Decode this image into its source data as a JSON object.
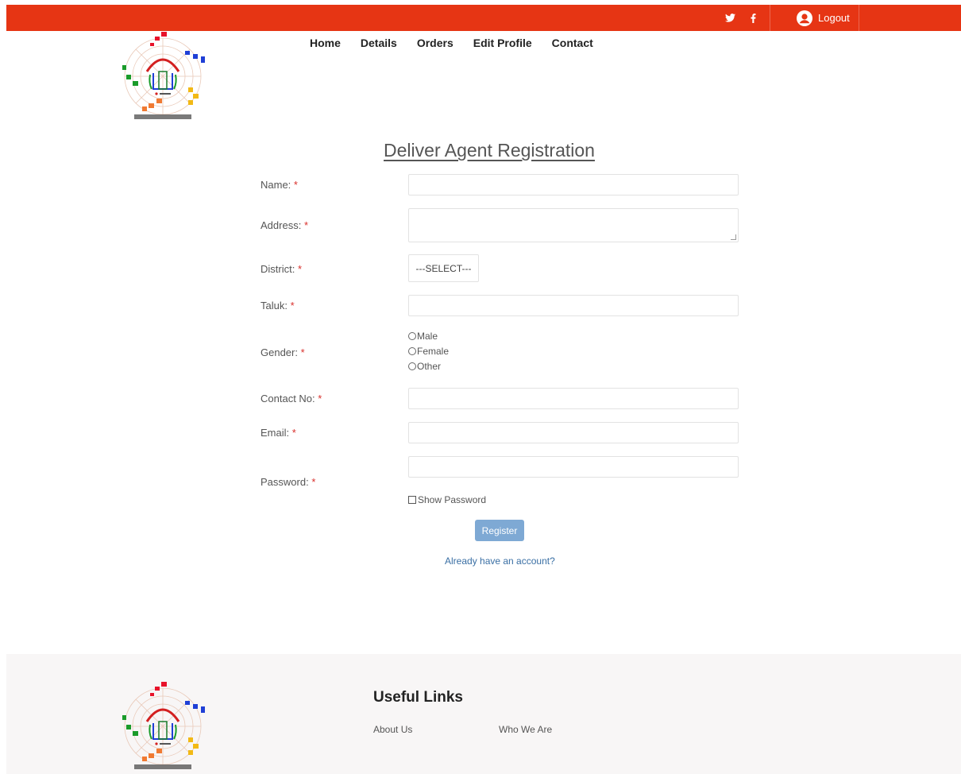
{
  "topbar": {
    "logout_label": "Logout",
    "color": "#e63514"
  },
  "nav": [
    "Home",
    "Details",
    "Orders",
    "Edit Profile",
    "Contact"
  ],
  "title": "Deliver Agent Registration",
  "form": {
    "name_label": "Name:",
    "address_label": "Address:",
    "district_label": "District:",
    "district_selected": "---SELECT---",
    "taluk_label": "Taluk:",
    "gender_label": "Gender:",
    "gender_options": [
      "Male",
      "Female",
      "Other"
    ],
    "contact_label": "Contact No:",
    "email_label": "Email:",
    "password_label": "Password:",
    "required_mark": "*",
    "show_password_label": "Show Password",
    "register_label": "Register",
    "already_label": "Already have an account?"
  },
  "footer": {
    "title": "Useful Links",
    "links": [
      "About Us",
      "Who We Are"
    ]
  },
  "icons": {
    "twitter": "twitter-icon",
    "facebook": "facebook-icon",
    "user": "user-icon"
  }
}
